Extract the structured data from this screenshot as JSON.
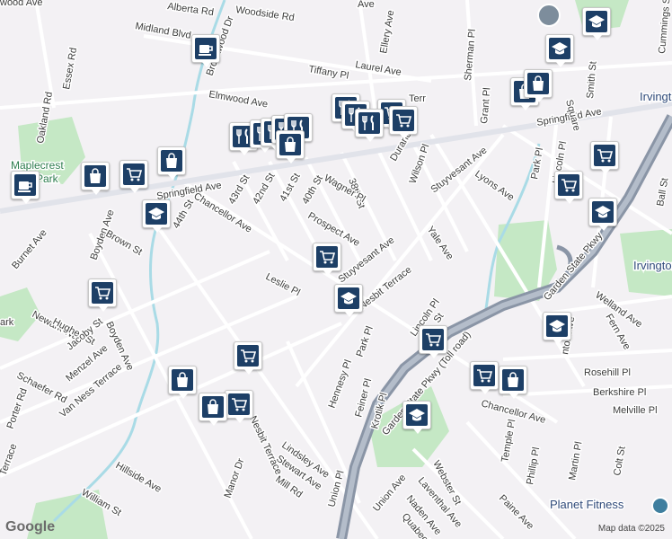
{
  "map": {
    "streets": [
      "Woodside Rd",
      "Midland Blvd",
      "Brookwood Dr",
      "Elmwood Ave",
      "Essex Rd",
      "Oakland Rd",
      "Laurel Ave",
      "Tiffany Pl",
      "Ellery Ave",
      "Sherman Pl",
      "Grant Pl",
      "Springfield Ave",
      "Springfield Ave",
      "Cummings St",
      "Linden Ave",
      "Smith St",
      "Square",
      "Burnet Ave",
      "Boyden Ave",
      "Brown St",
      "Chancellor Ave",
      "44th St",
      "43rd St",
      "42nd St",
      "41st St",
      "40th St",
      "Flo",
      "38th St",
      "Wagner Pl",
      "Durand Pl",
      "Wilson Pl",
      "Stuyvesant Ave",
      "Stuyvesant Ave",
      "Lyons Ave",
      "Park Pl",
      "Lincoln Pl",
      "Ball St",
      "Prospect Ave",
      "Nesbit Terrace",
      "Leslie Pl",
      "Yale Ave",
      "Newark Way",
      "Hughes St",
      "Jacoby St",
      "Boyden Ave",
      "Menzel Ave",
      "Schaefer Rd",
      "Porter Rd",
      "Van Ness Terrace",
      "Park Pl",
      "Hennesy Pl",
      "Lincoln Pl",
      "St",
      "Feiner Pl",
      "Krotik Pl",
      "Garden State Pkwy (Toll road)",
      "Garden State Pkwy",
      "Welland Ave",
      "Fern Ave",
      "Rosehill Pl",
      "Berkshire Pl",
      "Melville Pl",
      "Chancellor Ave",
      "Temple Pl",
      "Phillip Pl",
      "Martin Pl",
      "Colt St",
      "Webster St",
      "Laventhal Ave",
      "Naden Ave",
      "Quabeck Ave",
      "Paine Ave",
      "Union Ave",
      "Union Pl",
      "Nesbit Terrace",
      "Lindsley Ave",
      "Stewart Ave",
      "Mill Rd",
      "Manor Dr",
      "Hillside Ave",
      "William St",
      "Terrace",
      "wood Ave",
      "Alberta Rd",
      "Ave",
      "Terr",
      "nton Ave",
      "ark"
    ],
    "places": [
      "Irvington",
      "Irvington",
      "Maplecrest",
      "Park"
    ],
    "poi_business": "Planet Fitness",
    "attribution": "Map data ©2025",
    "logo": "Google",
    "colors": {
      "background": "#f3f1f4",
      "park": "#c5e8c5",
      "water": "#a9dbe6",
      "highway": "#8a95a6",
      "road": "#ffffff",
      "marker": "#1d3f66"
    },
    "markers": [
      {
        "type": "cafe"
      },
      {
        "type": "school"
      },
      {
        "type": "school"
      },
      {
        "type": "shopping"
      },
      {
        "type": "shopping"
      },
      {
        "type": "restaurant"
      },
      {
        "type": "restaurant"
      },
      {
        "type": "restaurant"
      },
      {
        "type": "restaurant"
      },
      {
        "type": "restaurant"
      },
      {
        "type": "grocery"
      },
      {
        "type": "grocery"
      },
      {
        "type": "restaurant"
      },
      {
        "type": "restaurant"
      },
      {
        "type": "restaurant"
      },
      {
        "type": "shopping"
      },
      {
        "type": "cafe"
      },
      {
        "type": "shopping"
      },
      {
        "type": "grocery"
      },
      {
        "type": "shopping"
      },
      {
        "type": "school"
      },
      {
        "type": "grocery"
      },
      {
        "type": "grocery"
      },
      {
        "type": "grocery"
      },
      {
        "type": "school"
      },
      {
        "type": "grocery"
      },
      {
        "type": "school"
      },
      {
        "type": "grocery"
      },
      {
        "type": "school"
      },
      {
        "type": "shopping"
      },
      {
        "type": "shopping"
      },
      {
        "type": "grocery"
      },
      {
        "type": "grocery"
      },
      {
        "type": "grocery"
      },
      {
        "type": "shopping"
      },
      {
        "type": "school"
      }
    ]
  }
}
